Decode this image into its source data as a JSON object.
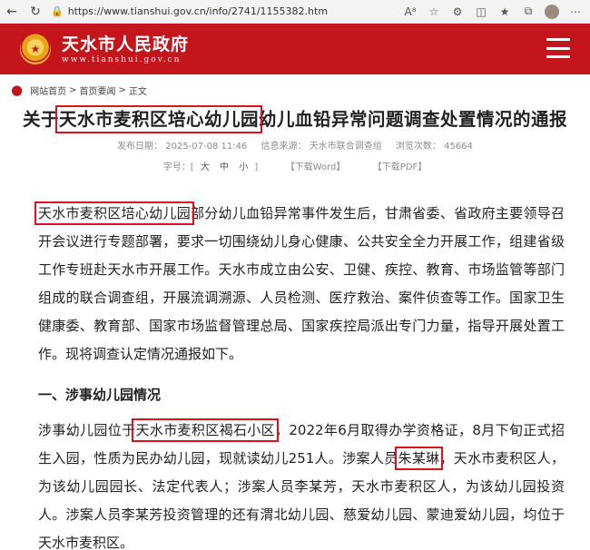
{
  "browser": {
    "url": "https://www.tianshui.gov.cn/info/2741/1155382.htm"
  },
  "site": {
    "name": "天水市人民政府",
    "domain": "www.tianshui.gov.cn"
  },
  "breadcrumb": {
    "home": "网站首页",
    "section": "首页要闻",
    "current": "正文",
    "separator": ">"
  },
  "article": {
    "title_prefix": "关于",
    "title_highlight": "天水市麦积区培心幼儿园",
    "title_suffix": "幼儿血铅异常问题调查处置情况的通报",
    "publish_date": "发布日期：  2025-07-08 11:46",
    "source": "信息来源：  天水市联合调查组",
    "views": "浏览次数：  45664",
    "font_size_label": "字号：[",
    "font_large": "大",
    "font_medium": "中",
    "font_small": "小",
    "font_close": "]",
    "download_word": "【下载Word】",
    "download_pdf": "【下载PDF】",
    "para1_highlight": "天水市麦积区培心幼儿园",
    "para1_text": "部分幼儿血铅异常事件发生后，甘肃省委、省政府主要领导召开会议进行专题部署，要求一切围绕幼儿身心健康、公共安全全力开展工作，组建省级工作专班赴天水市开展工作。天水市成立由公安、卫健、疾控、教育、市场监管等部门组成的联合调查组，开展流调溯源、人员检测、医疗救治、案件侦查等工作。国家卫生健康委、教育部、国家市场监督管理总局、国家疾控局派出专门力量，指导开展处置工作。现将调查认定情况通报如下。",
    "section1_heading": "一、涉事幼儿园情况",
    "para2_a": "涉事幼儿园位于",
    "para2_hl1": "天水市麦积区褐石小区",
    "para2_b": "，2022年6月取得办学资格证，8月下旬正式招生入园，性质为民办幼儿园，现就读幼儿251人。涉案人员",
    "para2_hl2": "朱某琳",
    "para2_c": "，天水市麦积区人，为该幼儿园园长、法定代表人；涉案人员李某芳，天水市麦积区人，为该幼儿园投资人。涉案人员李某芳投资管理的还有渭北幼儿园、慈爱幼儿园、蒙迪爱幼儿园，均位于天水市麦积区。"
  },
  "colors": {
    "header_red": "#c4141c",
    "highlight_red": "#e0101e"
  }
}
